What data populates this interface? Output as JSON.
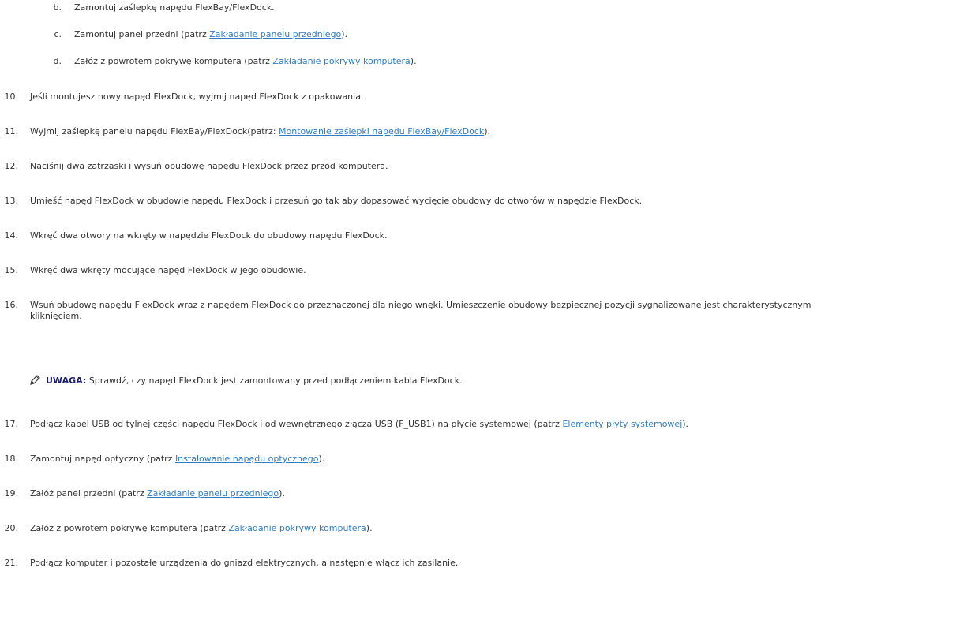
{
  "steps": [
    {
      "num": "b.",
      "kind": "sub",
      "parts": [
        {
          "t": "Zamontuj zaślepkę napędu FlexBay/FlexDock."
        }
      ]
    },
    {
      "num": "c.",
      "kind": "sub",
      "parts": [
        {
          "t": "Zamontuj panel przedni (patrz "
        },
        {
          "t": "Zakładanie panelu przedniego",
          "link": true
        },
        {
          "t": ")."
        }
      ]
    },
    {
      "num": "d.",
      "kind": "sub",
      "parts": [
        {
          "t": "Załóż z powrotem pokrywę komputera (patrz "
        },
        {
          "t": "Zakładanie pokrywy komputera",
          "link": true
        },
        {
          "t": ")."
        }
      ]
    },
    {
      "num": "10.",
      "kind": "main",
      "parts": [
        {
          "t": "Jeśli montujesz nowy napęd FlexDock, wyjmij napęd FlexDock z opakowania."
        }
      ]
    },
    {
      "num": "11.",
      "kind": "main",
      "parts": [
        {
          "t": "Wyjmij zaślepkę panelu napędu FlexBay/FlexDock(patrz: "
        },
        {
          "t": "Montowanie zaślepki napędu FlexBay/FlexDock",
          "link": true
        },
        {
          "t": ")."
        }
      ]
    },
    {
      "num": "12.",
      "kind": "main",
      "parts": [
        {
          "t": "Naciśnij dwa zatrzaski i wysuń obudowę napędu FlexDock przez przód komputera."
        }
      ]
    },
    {
      "num": "13.",
      "kind": "main",
      "parts": [
        {
          "t": "Umieść napęd FlexDock w obudowie napędu FlexDock i przesuń go tak aby dopasować wycięcie obudowy do otworów w napędzie FlexDock."
        }
      ]
    },
    {
      "num": "14.",
      "kind": "main",
      "parts": [
        {
          "t": "Wkręć dwa otwory na wkręty w napędzie FlexDock do obudowy napędu FlexDock."
        }
      ]
    },
    {
      "num": "15.",
      "kind": "main",
      "parts": [
        {
          "t": "Wkręć dwa wkręty mocujące napęd FlexDock w jego obudowie."
        }
      ]
    },
    {
      "num": "16.",
      "kind": "main",
      "parts": [
        {
          "t": "Wsuń obudowę napędu FlexDock wraz z napędem FlexDock do przeznaczonej dla niego wnęki. Umieszczenie obudowy bezpiecznej pozycji sygnalizowane jest charakterystycznym kliknięciem."
        }
      ]
    },
    {
      "num": "17.",
      "kind": "main",
      "parts": [
        {
          "t": "Podłącz kabel USB od tylnej części napędu FlexDock i od wewnętrznego złącza USB (F_USB1) na płycie systemowej (patrz "
        },
        {
          "t": "Elementy płyty systemowej",
          "link": true
        },
        {
          "t": ")."
        }
      ]
    },
    {
      "num": "18.",
      "kind": "main",
      "parts": [
        {
          "t": "Zamontuj napęd optyczny (patrz "
        },
        {
          "t": "Instalowanie napędu optycznego",
          "link": true
        },
        {
          "t": ")."
        }
      ]
    },
    {
      "num": "19.",
      "kind": "main",
      "parts": [
        {
          "t": "Załóż panel przedni (patrz "
        },
        {
          "t": "Zakładanie panelu przedniego",
          "link": true
        },
        {
          "t": ")."
        }
      ]
    },
    {
      "num": "20.",
      "kind": "main",
      "parts": [
        {
          "t": "Załóż z powrotem pokrywę komputera (patrz "
        },
        {
          "t": "Zakładanie pokrywy komputera",
          "link": true
        },
        {
          "t": ")."
        }
      ]
    },
    {
      "num": "21.",
      "kind": "main",
      "parts": [
        {
          "t": "Podłącz komputer i pozostałe urządzenia do gniazd elektrycznych, a następnie włącz ich zasilanie."
        }
      ]
    }
  ],
  "note": {
    "icon": "pencil-note-icon",
    "label": "UWAGA:",
    "text": " Sprawdź, czy napęd FlexDock jest zamontowany przed podłączeniem kabla FlexDock."
  },
  "colors": {
    "text": "#333333",
    "link": "#2e7cc6",
    "note_label": "#1a1a6e"
  }
}
